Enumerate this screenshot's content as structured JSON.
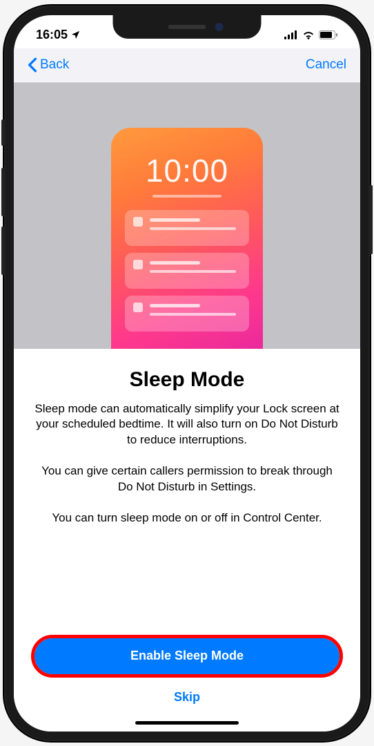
{
  "status": {
    "time": "16:05",
    "location_icon": "location-arrow"
  },
  "nav": {
    "back_label": "Back",
    "cancel_label": "Cancel"
  },
  "illustration": {
    "time": "10:00"
  },
  "content": {
    "title": "Sleep Mode",
    "paragraph1": "Sleep mode can automatically simplify your Lock screen at your scheduled bedtime. It will also turn on Do Not Disturb to reduce interruptions.",
    "paragraph2": "You can give certain callers permission to break through Do Not Disturb in Settings.",
    "paragraph3": "You can turn sleep mode on or off in Control Center."
  },
  "actions": {
    "primary_label": "Enable Sleep Mode",
    "secondary_label": "Skip"
  },
  "colors": {
    "accent": "#007aff",
    "highlight": "#ff0000"
  }
}
